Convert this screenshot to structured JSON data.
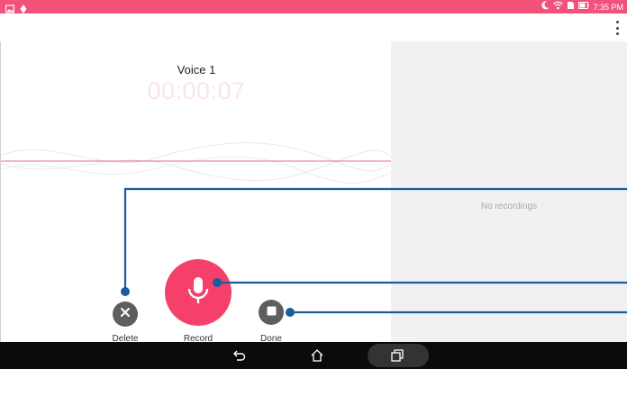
{
  "status_bar": {
    "time": "7:35 PM"
  },
  "recorder": {
    "title": "Voice 1",
    "timer": "00:00:07"
  },
  "recordings": {
    "empty_text": "No recordings"
  },
  "controls": {
    "delete_label": "Delete",
    "record_label": "Record",
    "done_label": "Done"
  },
  "colors": {
    "status_bar": "#f0527a",
    "record_button": "#f4406b",
    "secondary_button": "#5e5e5e",
    "callout_line": "#1b5c9a",
    "nav_bar": "#0b0b0b"
  },
  "icons": {
    "status_left": [
      "gallery-icon",
      "notification-icon"
    ],
    "status_right": [
      "moon-icon",
      "wifi-icon",
      "sim-icon",
      "battery-icon"
    ],
    "app_bar": "more-vert-icon",
    "controls": [
      "close-icon",
      "microphone-icon",
      "stop-icon"
    ],
    "nav": [
      "back-icon",
      "home-icon",
      "recents-icon"
    ]
  }
}
